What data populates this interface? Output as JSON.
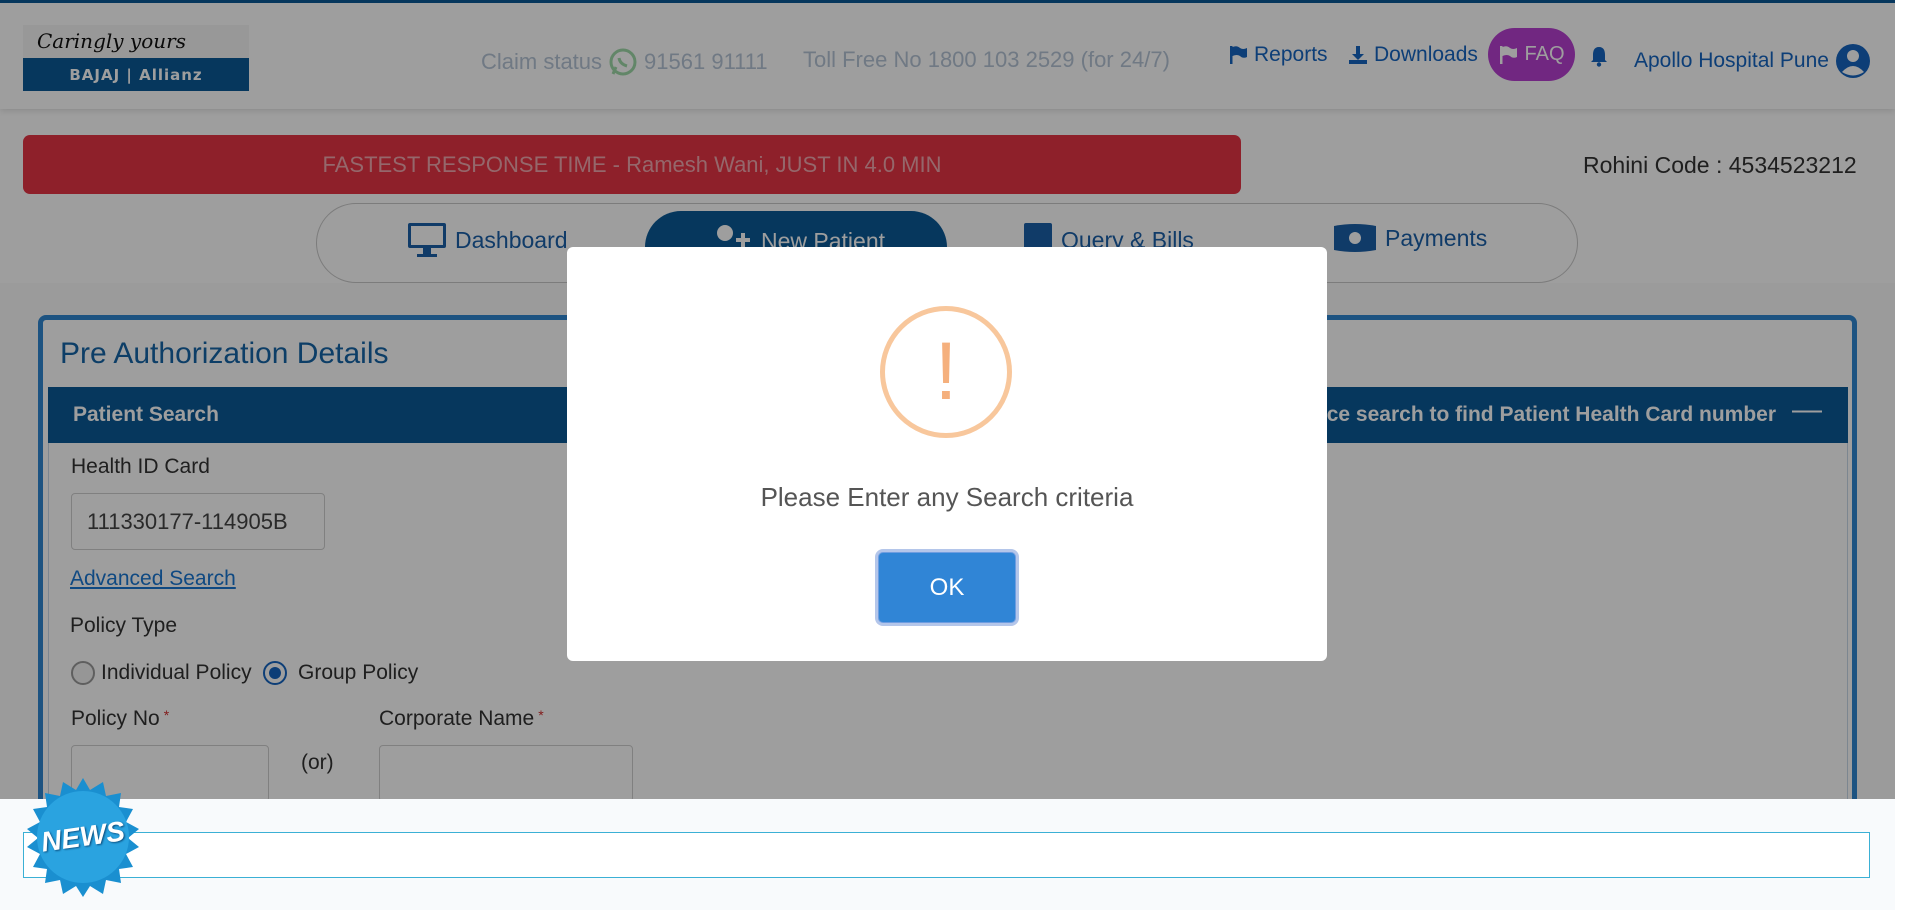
{
  "header": {
    "logo_tagline": "Caringly yours",
    "logo_brand": "BAJAJ | Allianz",
    "claim_status_label": "Claim status",
    "claim_status_phone": "91561 91111",
    "toll_free": "Toll Free No 1800 103 2529 (for 24/7)",
    "reports_label": "Reports",
    "downloads_label": "Downloads",
    "faq_label": "FAQ",
    "user_name": "Apollo Hospital Pune"
  },
  "alert_banner": "FASTEST RESPONSE TIME - Ramesh Wani, JUST IN 4.0 MIN",
  "rohini_code": "Rohini Code : 4534523212",
  "nav": {
    "dashboard": "Dashboard",
    "new_patient": "New Patient",
    "query_bills": "Query & Bills",
    "payments": "Payments",
    "active": "New Patient"
  },
  "panel": {
    "title": "Pre Authorization Details",
    "header_left": "Patient Search",
    "header_right": "ce search to find Patient Health Card number",
    "health_id_label": "Health ID Card",
    "health_id_value": "111330177-114905B",
    "advanced_search": "Advanced Search",
    "policy_type_label": "Policy Type",
    "individual_policy": "Individual Policy",
    "group_policy": "Group Policy",
    "selected_policy": "Group Policy",
    "policy_no_label": "Policy No",
    "or_label": "(or)",
    "corporate_name_label": "Corporate Name",
    "required_mark": "*"
  },
  "news": {
    "badge_label": "NEWS"
  },
  "modal": {
    "icon_glyph": "!",
    "message": "Please Enter any Search criteria",
    "ok_label": "OK"
  },
  "colors": {
    "primary": "#0a5a97",
    "alert": "#e53444",
    "faq": "#b640d0",
    "ok_button": "#3085d6",
    "warning": "#f8c79c"
  }
}
